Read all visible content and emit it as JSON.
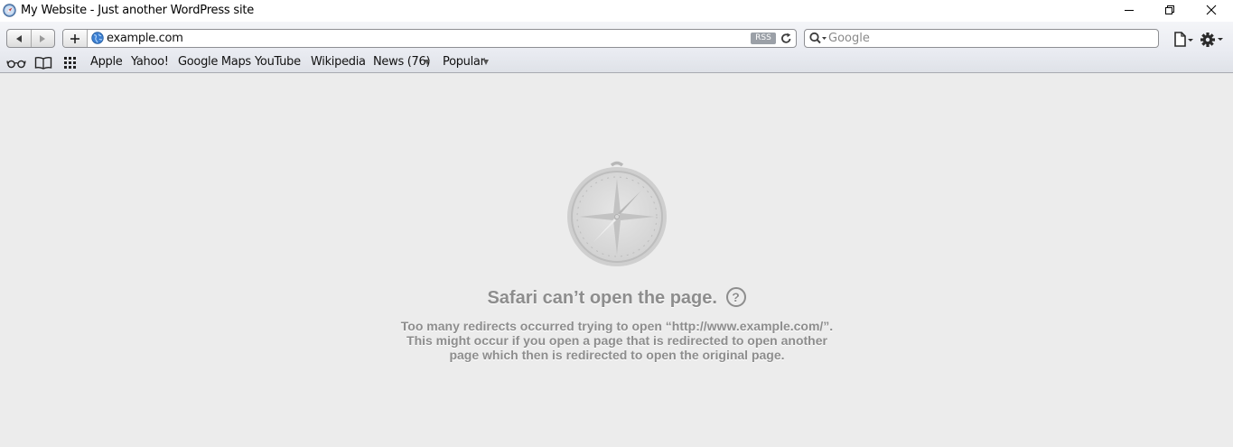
{
  "window": {
    "title": "My Website - Just another WordPress site"
  },
  "toolbar": {
    "address_url": "example.com",
    "rss_label": "RSS",
    "search_placeholder": "Google"
  },
  "bookmarks": {
    "items": [
      {
        "label": "Apple"
      },
      {
        "label": "Yahoo!"
      },
      {
        "label": "Google Maps"
      },
      {
        "label": "YouTube"
      },
      {
        "label": "Wikipedia"
      },
      {
        "label": "News (76)"
      },
      {
        "label": "Popular"
      }
    ]
  },
  "error": {
    "title": "Safari can’t open the page.",
    "help_symbol": "?",
    "message": "Too many redirects occurred trying to open “http://www.example.com/”. This might occur if you open a page that is redirected to open another page which then is redirected to open the original page."
  },
  "icons": {
    "title": "safari-icon",
    "back": "back-arrow-icon",
    "forward": "forward-arrow-icon",
    "add": "plus-icon",
    "site": "globe-icon",
    "reload": "reload-icon",
    "search": "search-icon",
    "page": "page-menu-icon",
    "settings": "gear-icon",
    "reading_list": "glasses-icon",
    "bookmarks": "book-icon",
    "top_sites": "grid-icon",
    "error": "compass-icon"
  },
  "colors": {
    "content_background": "#ececec",
    "error_text": "#8d8d8d",
    "toolbar_top": "#f4f5f8",
    "toolbar_bottom": "#e9ebf1"
  }
}
